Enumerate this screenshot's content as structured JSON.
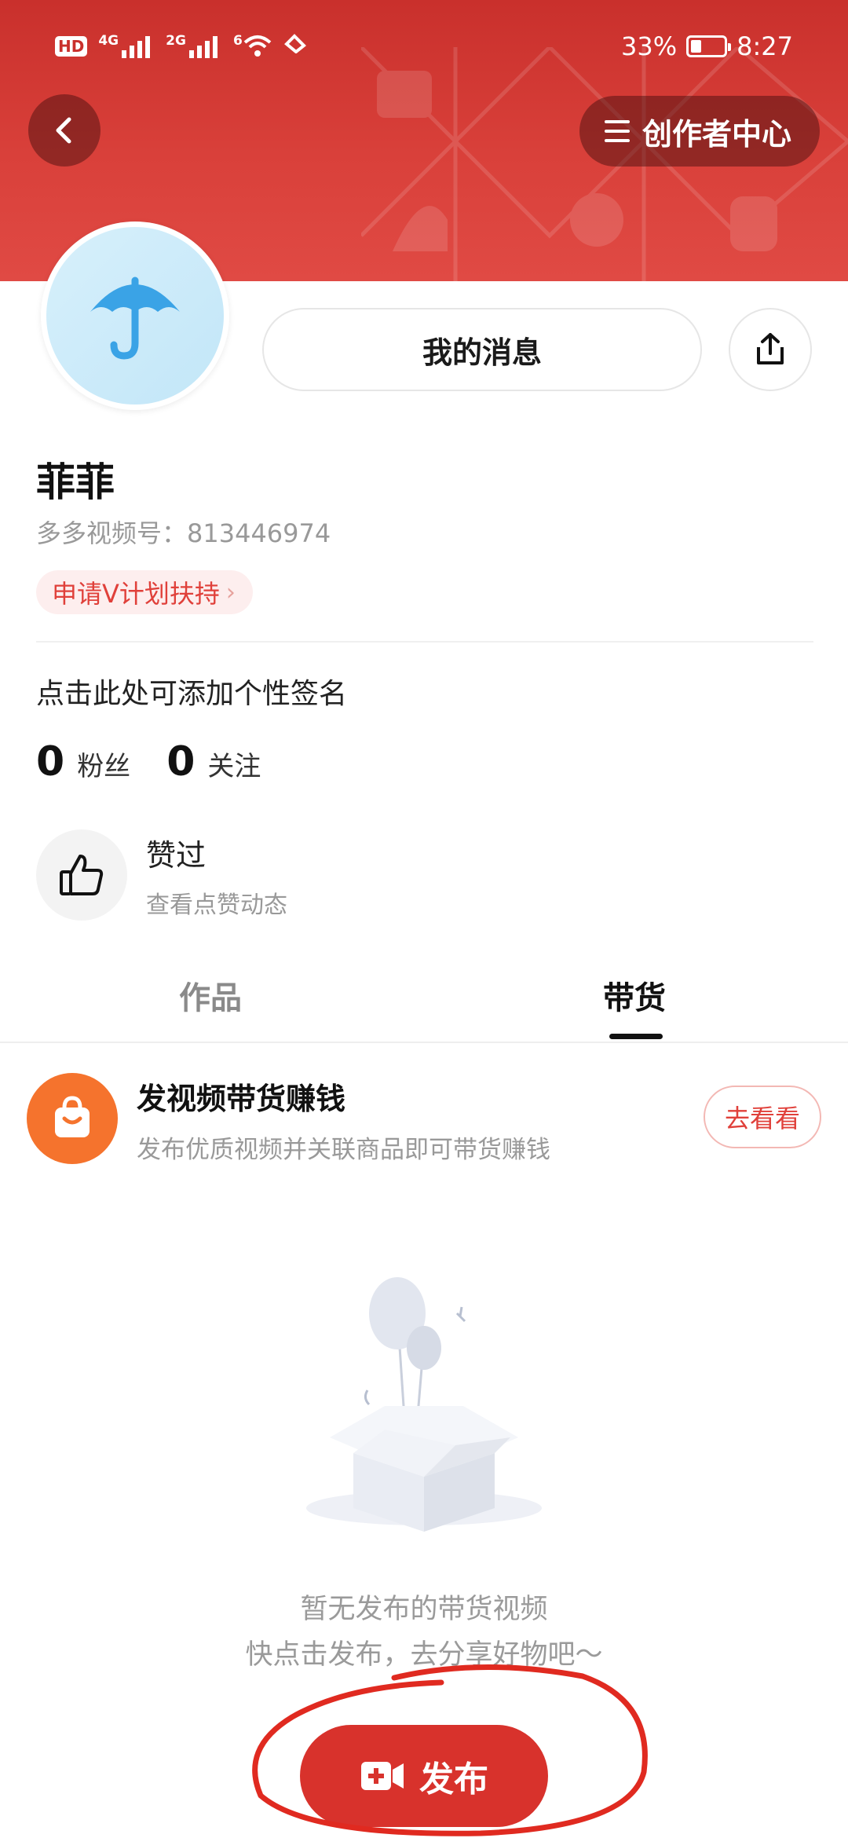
{
  "status_bar": {
    "left_icons": [
      "hd-icon",
      "4g-signal-icon",
      "2g-signal-icon",
      "wifi-icon",
      "nfc-icon"
    ],
    "hd_label": "HD",
    "net1": "4G",
    "net2": "2G",
    "net3": "6",
    "battery_percent": "33%",
    "battery_level": 0.33,
    "time": "8:27"
  },
  "header": {
    "back_icon": "chevron-left-icon",
    "creator_center_label": "创作者中心",
    "creator_icon": "menu-icon"
  },
  "profile": {
    "avatar_icon": "umbrella-icon",
    "my_messages_label": "我的消息",
    "share_icon": "share-icon",
    "username": "菲菲",
    "video_id_label": "多多视频号：813446974",
    "v_plan_label": "申请V计划扶持",
    "v_plan_chevron": "›",
    "signature_placeholder": "点击此处可添加个性签名",
    "stats": [
      {
        "value": "0",
        "label": "粉丝"
      },
      {
        "value": "0",
        "label": "关注"
      }
    ],
    "liked": {
      "title": "赞过",
      "subtitle": "查看点赞动态",
      "icon": "thumbs-up-icon"
    }
  },
  "tabs": [
    {
      "label": "作品",
      "active": false
    },
    {
      "label": "带货",
      "active": true
    }
  ],
  "promo": {
    "icon": "shopping-bag-icon",
    "title": "发视频带货赚钱",
    "subtitle": "发布优质视频并关联商品即可带货赚钱",
    "button_label": "去看看"
  },
  "empty_state": {
    "illustration": "balloon-box-illustration",
    "line1": "暂无发布的带货视频",
    "line2": "快点击发布，去分享好物吧～",
    "publish_label": "发布",
    "publish_icon": "video-add-icon"
  },
  "colors": {
    "brand_red": "#d8322c",
    "banner_red": "#c9302c",
    "promo_orange": "#f5732d",
    "annotation_red": "#e02a20"
  }
}
